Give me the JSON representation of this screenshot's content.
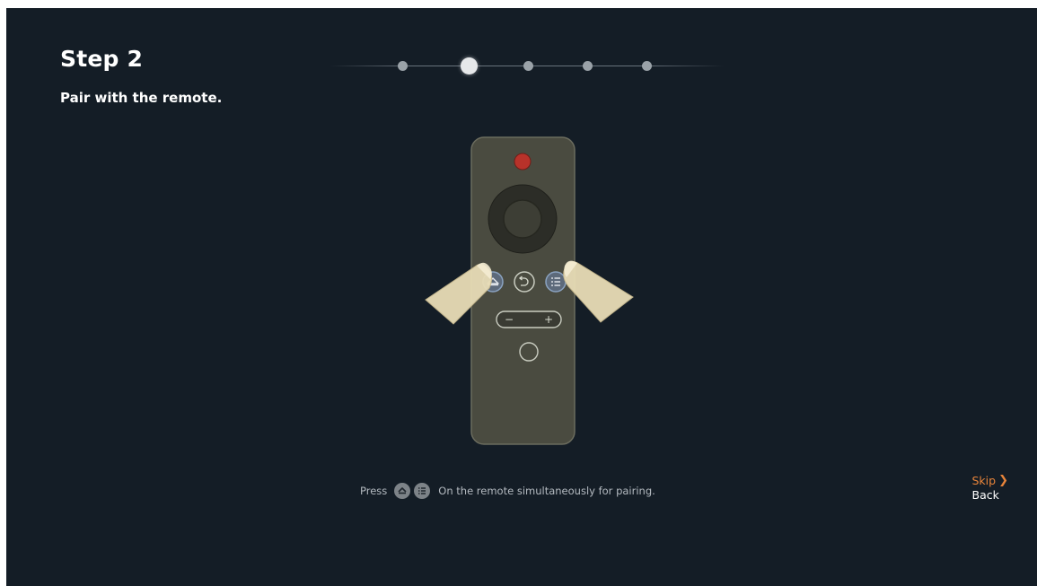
{
  "step": {
    "title": "Step 2",
    "subtitle": "Pair with the remote."
  },
  "progress": {
    "total_steps": 5,
    "current_step": 2
  },
  "remote_illustration": {
    "buttons": [
      "power",
      "dpad",
      "ok",
      "home",
      "back",
      "menu",
      "volume",
      "voice"
    ],
    "highlighted_buttons": [
      "home",
      "menu"
    ],
    "volume_minus": "−",
    "volume_plus": "+"
  },
  "instruction": {
    "prefix": "Press",
    "suffix": "On the remote simultaneously for pairing.",
    "icons": [
      "home-icon",
      "menu-icon"
    ]
  },
  "nav": {
    "skip_label": "Skip",
    "skip_arrow": "❯",
    "back_label": "Back"
  },
  "colors": {
    "background": "#141d26",
    "accent": "#e8843a",
    "power": "#b8322a",
    "remote_body": "#4a4b40"
  }
}
